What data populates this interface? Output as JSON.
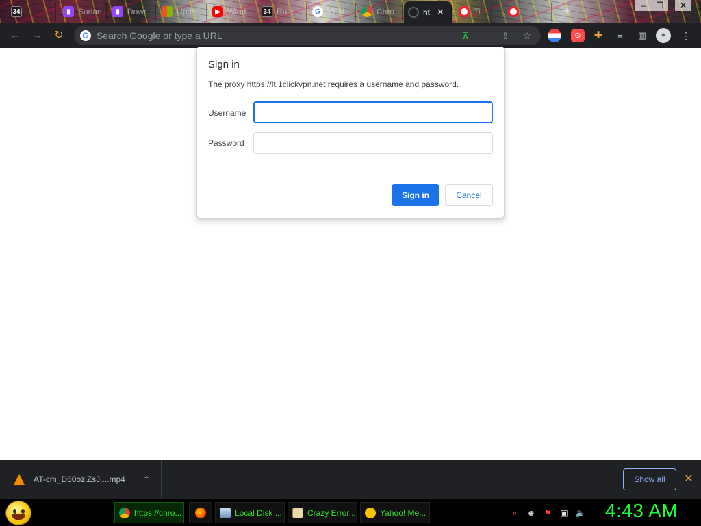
{
  "browser": {
    "tabs": [
      {
        "icon": "34-icon",
        "title": "",
        "color": "#1a1a1a"
      },
      {
        "icon": "twitch-icon",
        "title": "Surian",
        "color": "#9146ff"
      },
      {
        "icon": "twitch-icon",
        "title": "Dowr",
        "color": "#9146ff"
      },
      {
        "icon": "microsoft-icon",
        "title": "Upda",
        "color": "#f25022"
      },
      {
        "icon": "youtube-icon",
        "title": "Wind",
        "color": "#ff0000"
      },
      {
        "icon": "34-icon",
        "title": "Rule",
        "color": "#1a1a1a"
      },
      {
        "icon": "google-icon",
        "title": "VPN",
        "color": "#ffffff"
      },
      {
        "icon": "chrome-icon",
        "title": "Chro",
        "color": "#ffffff"
      },
      {
        "icon": "loading-icon",
        "title": "ht",
        "color": "#5f6368"
      },
      {
        "icon": "opera-icon",
        "title": "Ti",
        "color": "#ff1b2d"
      },
      {
        "icon": "opera-icon",
        "title": "",
        "color": "#ff1b2d"
      }
    ],
    "new_tab": "+",
    "window_controls": {
      "minimize": "–",
      "restore": "❐",
      "close": "✕"
    }
  },
  "toolbar": {
    "omnibox_placeholder": "Search Google or type a URL",
    "google_g": "G"
  },
  "dialog": {
    "title": "Sign in",
    "message": "The proxy https://lt.1clickvpn.net requires a username and password.",
    "username_label": "Username",
    "username_value": "",
    "password_label": "Password",
    "password_value": "",
    "sign_in_button": "Sign in",
    "cancel_button": "Cancel"
  },
  "downloads": {
    "file_name": "AT-cm_D60oziZsJ....mp4",
    "show_all": "Show all",
    "close": "✕"
  },
  "taskbar": {
    "items": [
      {
        "label": "https://chro...",
        "icon": "chrome-icon",
        "active": true
      },
      {
        "label": "",
        "icon": "firefox-icon",
        "active": false
      },
      {
        "label": "Local Disk ...",
        "icon": "drive-icon",
        "active": false
      },
      {
        "label": "Crazy Error...",
        "icon": "document-icon",
        "active": false
      },
      {
        "label": "Yahoo! Me...",
        "icon": "yahoo-messenger-icon",
        "active": false
      }
    ],
    "clock": "4:43 AM"
  }
}
